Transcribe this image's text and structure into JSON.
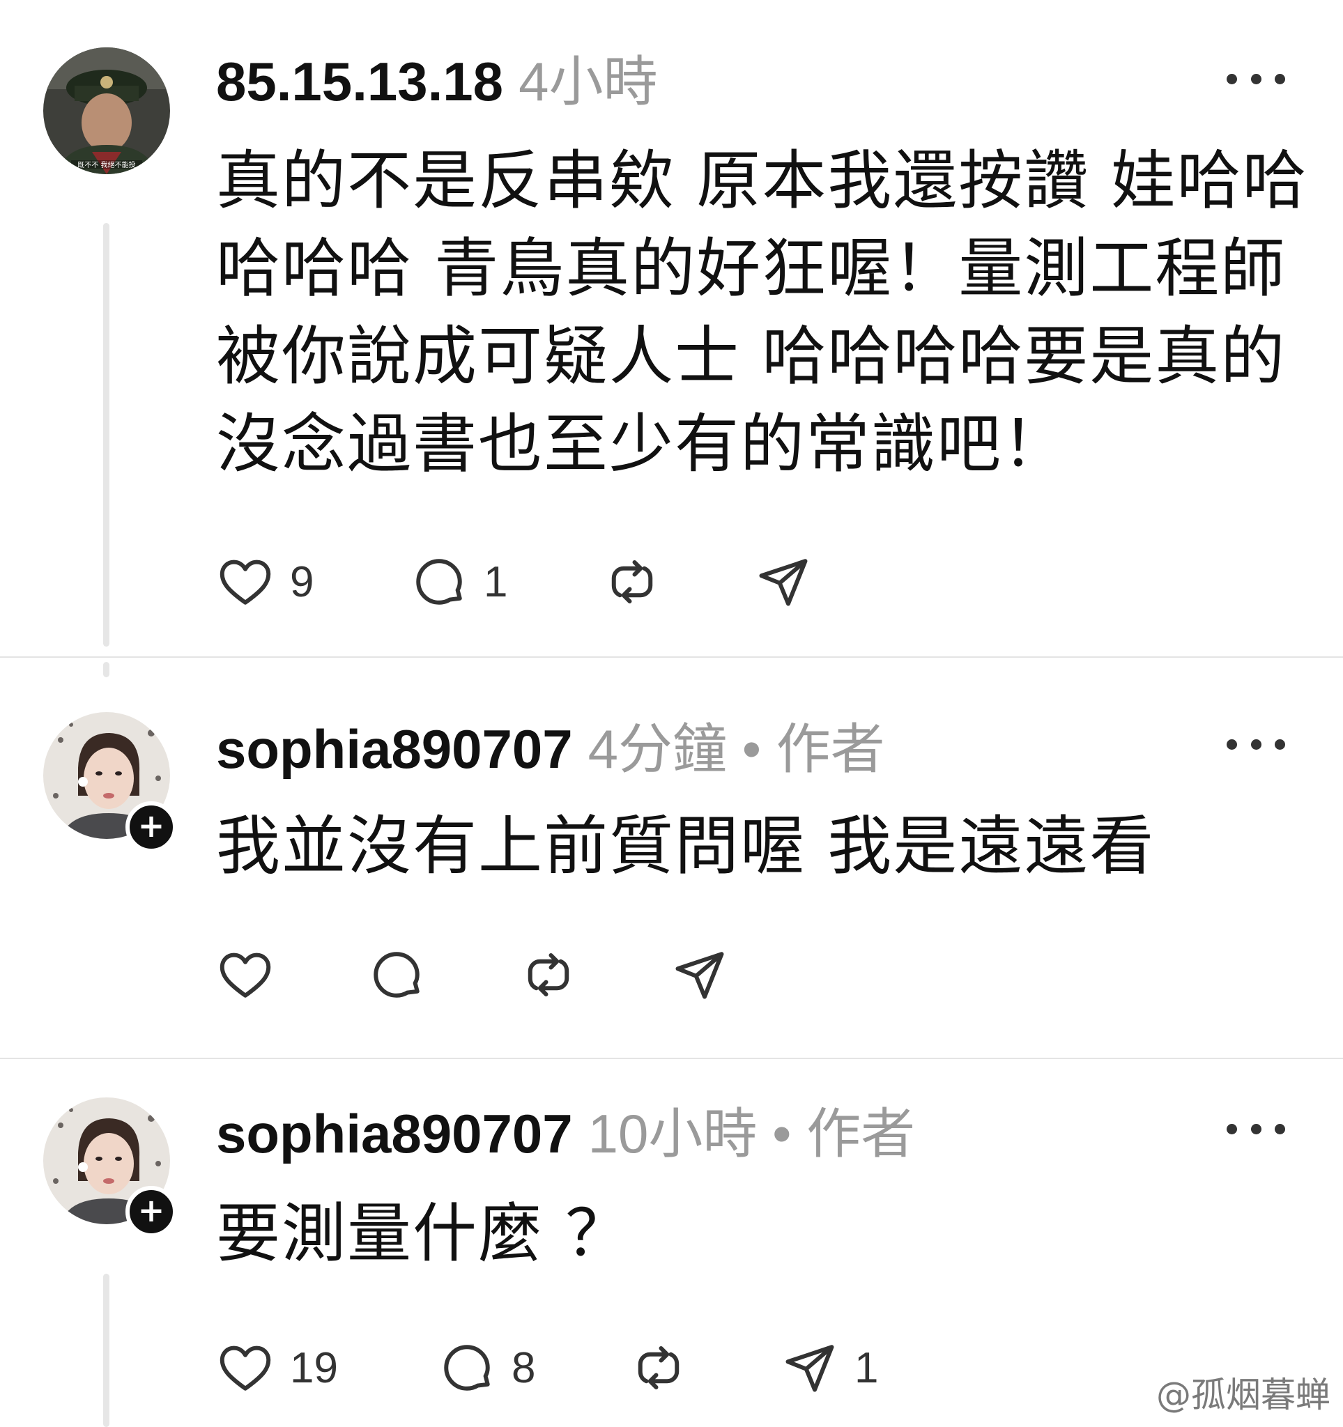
{
  "comments": [
    {
      "username": "85.15.13.18",
      "meta": "4小時",
      "text": "真的不是反串欸 原本我還按讚 娃哈哈哈哈哈 青鳥真的好狂喔！量測工程師被你說成可疑人士 哈哈哈哈要是真的沒念過書也至少有的常識吧！",
      "avatar_caption": "既不不 我絕不能投",
      "likes": "9",
      "replies": "1",
      "reposts": "",
      "shares": ""
    },
    {
      "username": "sophia890707",
      "meta": "4分鐘 • 作者",
      "text": "我並沒有上前質問喔 我是遠遠看",
      "likes": "",
      "replies": "",
      "reposts": "",
      "shares": ""
    },
    {
      "username": "sophia890707",
      "meta": "10小時 • 作者",
      "text": "要測量什麼 ？",
      "likes": "19",
      "replies": "8",
      "reposts": "",
      "shares": "1"
    }
  ],
  "icons": {
    "like": "heart-icon",
    "reply": "comment-bubble-icon",
    "repost": "repost-icon",
    "share": "send-icon",
    "more": "more-dots-icon",
    "follow": "plus-icon"
  },
  "watermark": "@孤烟暮蝉"
}
